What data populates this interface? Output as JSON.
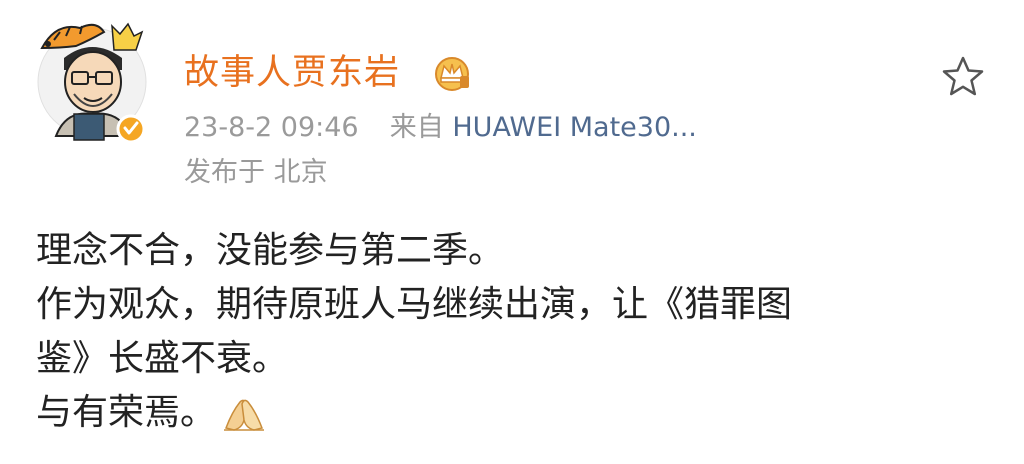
{
  "post": {
    "username": "故事人贾东岩",
    "timestamp": "23-8-2 09:46",
    "source_prefix": "来自",
    "source_device": "HUAWEI Mate30...",
    "location": "发布于 北京",
    "lines": [
      "理念不合，没能参与第二季。",
      "作为观众，期待原班人马继续出演，让《猎罪图",
      "鉴》长盛不衰。",
      "与有荣焉。"
    ]
  },
  "icons": {
    "crown": "crown-badge-icon",
    "star": "star-favorite-icon",
    "verified": "verified-badge-icon",
    "emoji": "pray-hands-emoji-icon"
  },
  "colors": {
    "username": "#e8711f",
    "source_link": "#506a8f",
    "meta_gray": "#9a9a9a",
    "verified": "#f5a623"
  }
}
